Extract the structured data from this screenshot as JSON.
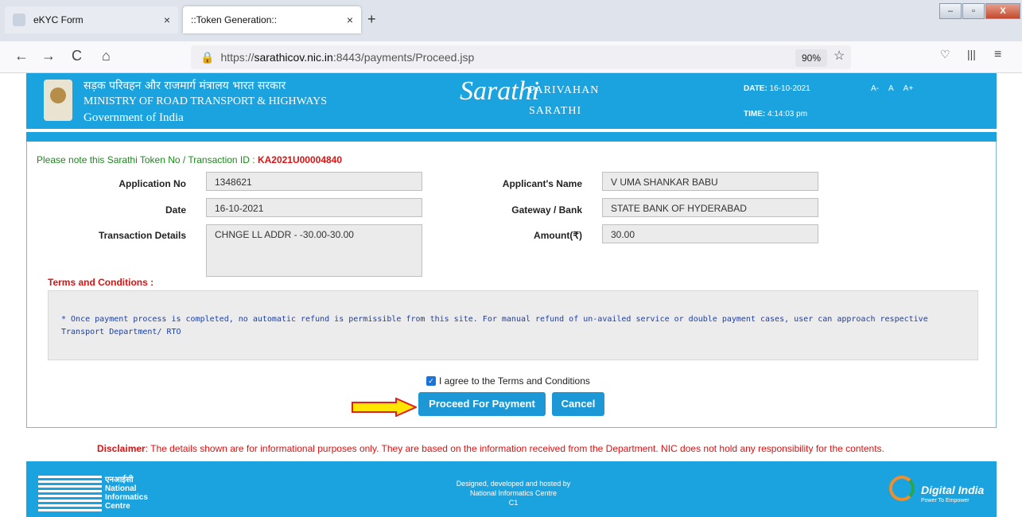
{
  "browser": {
    "tabs": [
      {
        "title": "eKYC Form",
        "close": "×"
      },
      {
        "title": "::Token Generation::",
        "close": "×"
      }
    ],
    "new_tab": "+",
    "nav": {
      "back": "←",
      "forward": "→",
      "reload": "C",
      "home": "⌂"
    },
    "url_prefix": "https://",
    "url_host": "sarathicov.nic.in",
    "url_rest": ":8443/payments/Proceed.jsp",
    "zoom": "90%",
    "window": {
      "minimize": "–",
      "maximize": "▫",
      "close": "X"
    }
  },
  "header": {
    "hindi_title": "सड़क परिवहन और राजमार्ग मंत्रालय भारत सरकार",
    "ministry": "MINISTRY OF ROAD TRANSPORT & HIGHWAYS",
    "government": "Government of India",
    "logo_text": "Sarathi",
    "brand_line1": "PARIVAHAN",
    "brand_line2": "SARATHI",
    "date_label": "DATE:",
    "date_value": "16-10-2021",
    "time_label": "TIME:",
    "time_value": "4:14:03 pm",
    "font_small": "A-",
    "font_normal": "A",
    "font_large": "A+"
  },
  "form": {
    "note_text": "Please note this Sarathi Token No / Transaction ID :",
    "token_id": "KA2021U00004840",
    "application_no_label": "Application No",
    "application_no": "1348621",
    "date_label": "Date",
    "date": "16-10-2021",
    "transaction_details_label": "Transaction Details",
    "transaction_details": "CHNGE LL ADDR  - -30.00-30.00",
    "applicant_name_label": "Applicant's Name",
    "applicant_name": "V UMA SHANKAR BABU",
    "gateway_label": "Gateway / Bank",
    "gateway": "STATE BANK OF HYDERABAD",
    "amount_label": "Amount(₹)",
    "amount": "30.00"
  },
  "terms": {
    "heading": "Terms and Conditions :",
    "text": "* Once payment process is completed, no automatic refund is permissible from this site. For manual refund of un-availed service or double payment cases, user can approach respective Transport Department/ RTO",
    "agree_label": "I agree to the Terms and Conditions",
    "agree_checked": true
  },
  "actions": {
    "proceed": "Proceed For Payment",
    "cancel": "Cancel"
  },
  "disclaimer": {
    "label": "Disclaimer",
    "text": ": The details shown are for informational purposes only. They are based on the information received from the Department. NIC does not hold any responsibility for the contents."
  },
  "footer": {
    "nic_hindi": "एनआईसी",
    "nic_line1": "National",
    "nic_line2": "Informatics",
    "nic_line3": "Centre",
    "designed_line1": "Designed, developed and hosted by",
    "designed_line2": "National Informatics Centre",
    "designed_line3": "C1",
    "digital_india": "Digital India",
    "digital_india_sub": "Power To Empower"
  }
}
